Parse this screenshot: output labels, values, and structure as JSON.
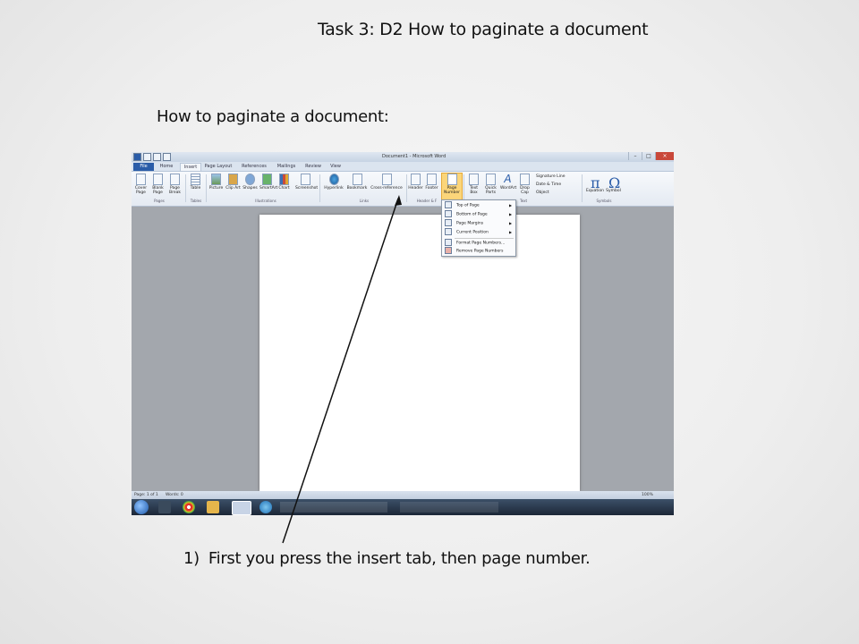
{
  "slide": {
    "title": "Task 3: D2 How to paginate a document",
    "subtitle": "How to paginate a document:",
    "step_number": "1)",
    "step_text": "First you press the insert tab, then page number."
  },
  "word": {
    "window_title": "Document1 - Microsoft Word",
    "tabs": [
      "File",
      "Home",
      "Insert",
      "Page Layout",
      "References",
      "Mailings",
      "Review",
      "View"
    ],
    "active_tab": "Insert",
    "ribbon": {
      "cover_page": "Cover Page",
      "blank_page": "Blank Page",
      "page_break": "Page Break",
      "table": "Table",
      "picture": "Picture",
      "clip_art": "Clip Art",
      "shapes": "Shapes",
      "smartart": "SmartArt",
      "chart": "Chart",
      "screenshot": "Screenshot",
      "hyperlink": "Hyperlink",
      "bookmark": "Bookmark",
      "cross_reference": "Cross-reference",
      "header": "Header",
      "footer": "Footer",
      "page_number": "Page Number",
      "text_box": "Text Box",
      "quick_parts": "Quick Parts",
      "wordart": "WordArt",
      "drop_cap": "Drop Cap",
      "signature_line": "Signature Line",
      "date_time": "Date & Time",
      "object": "Object",
      "equation": "Equation",
      "symbol": "Symbol"
    },
    "groups": {
      "pages": "Pages",
      "tables": "Tables",
      "illustrations": "Illustrations",
      "links": "Links",
      "header_footer": "Header & F",
      "text": "Text",
      "symbols": "Symbols"
    },
    "page_number_menu": [
      "Top of Page",
      "Bottom of Page",
      "Page Margins",
      "Current Position",
      "Format Page Numbers...",
      "Remove Page Numbers"
    ],
    "status": {
      "page": "Page: 1 of 1",
      "words": "Words: 0",
      "zoom": "100%"
    }
  }
}
